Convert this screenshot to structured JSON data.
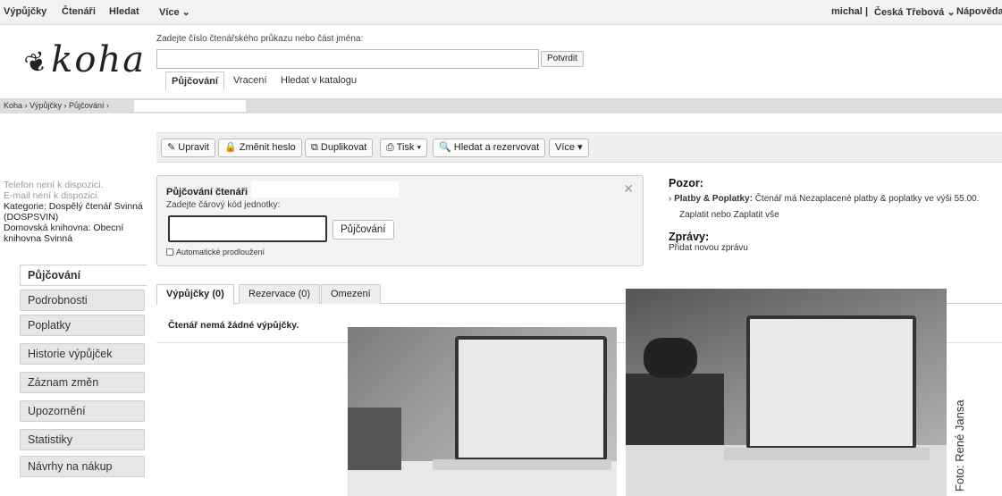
{
  "topnav": {
    "items": [
      "Výpůjčky",
      "Čtenáři",
      "Hledat",
      "Více ⌄"
    ],
    "user": "michal",
    "branch": "Česká Třebová ⌄",
    "help": "Nápověda",
    "separator": "|"
  },
  "logo": {
    "text": "koha",
    "mark": "❦"
  },
  "patron_search": {
    "label": "Zadejte číslo čtenářského průkazu nebo část jména:",
    "submit": "Potvrdit",
    "tabs": [
      "Půjčování",
      "Vracení",
      "Hledat v katalogu"
    ]
  },
  "breadcrumb": "Koha › Výpůjčky › Půjčování ›",
  "toolbar": {
    "edit": "✎ Upravit",
    "password": "🔒 Změnit heslo",
    "duplicate": "⧉ Duplikovat",
    "print": "⎙ Tisk ▾",
    "search_hold": "🔍 Hledat a rezervovat",
    "more": "Více ▾"
  },
  "patron_info": {
    "phone": "Telefon není k dispozici.",
    "email": "E-mail není k dispozici.",
    "category": "Kategorie: Dospělý čtenář Svinná (DOSPSVIN)",
    "library": "Domovská knihovna: Obecní knihovna Svinná"
  },
  "sidemenu": [
    "Půjčování",
    "Podrobnosti",
    "Poplatky",
    "Historie výpůjček",
    "Záznam změn",
    "Upozornění",
    "Statistiky",
    "Návrhy na nákup"
  ],
  "checkout": {
    "title": "Půjčování čtenáři",
    "barcode_label": "Zadejte čárový kód jednotky:",
    "button": "Půjčování",
    "auto_renew": "Automatické prodloužení",
    "close": "✕"
  },
  "notes": {
    "attention_title": "Pozor:",
    "fines_label": "Platby & Poplatky:",
    "fines_text": "Čtenář má Nezaplacené platby & poplatky ve výši 55.00.",
    "pay": "Zaplatit",
    "or": "nebo",
    "pay_all": "Zaplatit vše",
    "messages_title": "Zprávy:",
    "add_message": "Přidat novou zprávu"
  },
  "tabs": [
    "Výpůjčky (0)",
    "Rezervace (0)",
    "Omezení"
  ],
  "no_checkouts": "Čtenář nemá žádné výpůjčky.",
  "credit": "Foto: René Jansa"
}
